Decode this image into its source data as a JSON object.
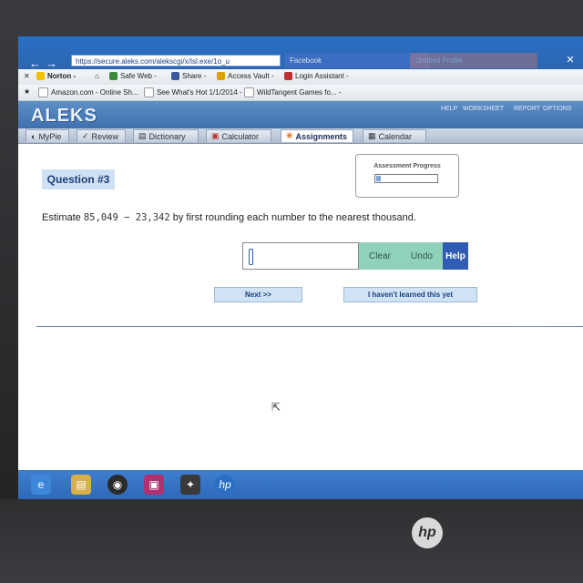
{
  "browser": {
    "url": "https://secure.aleks.com/alekscgi/x/Isl.exe/1o_u",
    "tab_facebook": "Facebook",
    "tab_other": "Untitled Profile",
    "toolbar1": {
      "norton": "Norton -",
      "safe_web": "Safe Web -",
      "share": "Share -",
      "access_vault": "Access Vault -",
      "login_assistant": "Login Assistant -"
    },
    "toolbar2": {
      "fav1": "Amazon.com - Online Sh...",
      "fav2": "See What's Hot 1/1/2014 -",
      "fav3": "WildTangent Games fo... -"
    }
  },
  "aleks": {
    "logo": "ALEKS",
    "head_links": [
      "HELP",
      "WORKSHEET",
      "REPORT",
      "OPTIONS"
    ],
    "menu": [
      {
        "label": "MyPie",
        "icon": "pie-icon"
      },
      {
        "label": "Review",
        "icon": "check-icon"
      },
      {
        "label": "Dictionary",
        "icon": "book-icon"
      },
      {
        "label": "Calculator",
        "icon": "calculator-icon"
      },
      {
        "label": "Assignments",
        "icon": "assignments-icon"
      },
      {
        "label": "Calendar",
        "icon": "calendar-icon"
      }
    ]
  },
  "question": {
    "label": "Question #3",
    "progress_title": "Assessment Progress",
    "progress_fraction": 0.08,
    "prompt_prefix": "Estimate ",
    "prompt_expr": "85,049 − 23,342",
    "prompt_suffix": " by first rounding each number to the nearest thousand.",
    "answer_value": "",
    "buttons": {
      "clear": "Clear",
      "undo": "Undo",
      "help": "Help",
      "next": "Next >>",
      "not_learned": "I haven't learned this yet"
    }
  },
  "device": {
    "brand": "hp"
  }
}
